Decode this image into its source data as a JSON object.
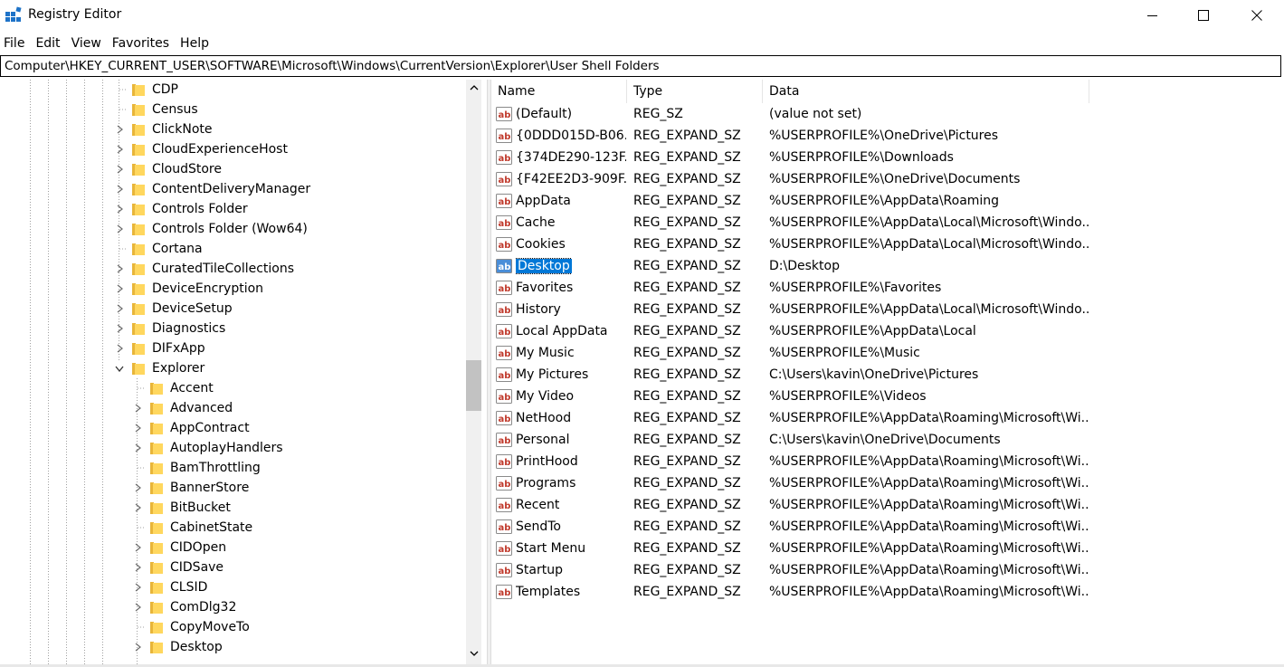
{
  "window": {
    "title": "Registry Editor"
  },
  "menu": [
    "File",
    "Edit",
    "View",
    "Favorites",
    "Help"
  ],
  "address": "Computer\\HKEY_CURRENT_USER\\SOFTWARE\\Microsoft\\Windows\\CurrentVersion\\Explorer\\User Shell Folders",
  "tree": {
    "items": [
      {
        "label": "CDP",
        "level": 1,
        "expander": "none"
      },
      {
        "label": "Census",
        "level": 1,
        "expander": "none"
      },
      {
        "label": "ClickNote",
        "level": 1,
        "expander": "collapsed"
      },
      {
        "label": "CloudExperienceHost",
        "level": 1,
        "expander": "collapsed"
      },
      {
        "label": "CloudStore",
        "level": 1,
        "expander": "collapsed"
      },
      {
        "label": "ContentDeliveryManager",
        "level": 1,
        "expander": "collapsed"
      },
      {
        "label": "Controls Folder",
        "level": 1,
        "expander": "collapsed"
      },
      {
        "label": "Controls Folder (Wow64)",
        "level": 1,
        "expander": "collapsed"
      },
      {
        "label": "Cortana",
        "level": 1,
        "expander": "none"
      },
      {
        "label": "CuratedTileCollections",
        "level": 1,
        "expander": "collapsed"
      },
      {
        "label": "DeviceEncryption",
        "level": 1,
        "expander": "collapsed"
      },
      {
        "label": "DeviceSetup",
        "level": 1,
        "expander": "collapsed"
      },
      {
        "label": "Diagnostics",
        "level": 1,
        "expander": "collapsed"
      },
      {
        "label": "DIFxApp",
        "level": 1,
        "expander": "collapsed"
      },
      {
        "label": "Explorer",
        "level": 1,
        "expander": "expanded"
      },
      {
        "label": "Accent",
        "level": 2,
        "expander": "none"
      },
      {
        "label": "Advanced",
        "level": 2,
        "expander": "collapsed"
      },
      {
        "label": "AppContract",
        "level": 2,
        "expander": "collapsed"
      },
      {
        "label": "AutoplayHandlers",
        "level": 2,
        "expander": "collapsed"
      },
      {
        "label": "BamThrottling",
        "level": 2,
        "expander": "none"
      },
      {
        "label": "BannerStore",
        "level": 2,
        "expander": "collapsed"
      },
      {
        "label": "BitBucket",
        "level": 2,
        "expander": "collapsed"
      },
      {
        "label": "CabinetState",
        "level": 2,
        "expander": "none"
      },
      {
        "label": "CIDOpen",
        "level": 2,
        "expander": "collapsed"
      },
      {
        "label": "CIDSave",
        "level": 2,
        "expander": "collapsed"
      },
      {
        "label": "CLSID",
        "level": 2,
        "expander": "collapsed"
      },
      {
        "label": "ComDlg32",
        "level": 2,
        "expander": "collapsed"
      },
      {
        "label": "CopyMoveTo",
        "level": 2,
        "expander": "none"
      },
      {
        "label": "Desktop",
        "level": 2,
        "expander": "collapsed"
      }
    ]
  },
  "list": {
    "columns": [
      "Name",
      "Type",
      "Data"
    ],
    "selected": "Desktop",
    "rows": [
      {
        "name": "(Default)",
        "type": "REG_SZ",
        "data": "(value not set)"
      },
      {
        "name": "{0DDD015D-B06...",
        "type": "REG_EXPAND_SZ",
        "data": "%USERPROFILE%\\OneDrive\\Pictures"
      },
      {
        "name": "{374DE290-123F...",
        "type": "REG_EXPAND_SZ",
        "data": "%USERPROFILE%\\Downloads"
      },
      {
        "name": "{F42EE2D3-909F...",
        "type": "REG_EXPAND_SZ",
        "data": "%USERPROFILE%\\OneDrive\\Documents"
      },
      {
        "name": "AppData",
        "type": "REG_EXPAND_SZ",
        "data": "%USERPROFILE%\\AppData\\Roaming"
      },
      {
        "name": "Cache",
        "type": "REG_EXPAND_SZ",
        "data": "%USERPROFILE%\\AppData\\Local\\Microsoft\\Windo..."
      },
      {
        "name": "Cookies",
        "type": "REG_EXPAND_SZ",
        "data": "%USERPROFILE%\\AppData\\Local\\Microsoft\\Windo..."
      },
      {
        "name": "Desktop",
        "type": "REG_EXPAND_SZ",
        "data": "D:\\Desktop"
      },
      {
        "name": "Favorites",
        "type": "REG_EXPAND_SZ",
        "data": "%USERPROFILE%\\Favorites"
      },
      {
        "name": "History",
        "type": "REG_EXPAND_SZ",
        "data": "%USERPROFILE%\\AppData\\Local\\Microsoft\\Windo..."
      },
      {
        "name": "Local AppData",
        "type": "REG_EXPAND_SZ",
        "data": "%USERPROFILE%\\AppData\\Local"
      },
      {
        "name": "My Music",
        "type": "REG_EXPAND_SZ",
        "data": "%USERPROFILE%\\Music"
      },
      {
        "name": "My Pictures",
        "type": "REG_EXPAND_SZ",
        "data": "C:\\Users\\kavin\\OneDrive\\Pictures"
      },
      {
        "name": "My Video",
        "type": "REG_EXPAND_SZ",
        "data": "%USERPROFILE%\\Videos"
      },
      {
        "name": "NetHood",
        "type": "REG_EXPAND_SZ",
        "data": "%USERPROFILE%\\AppData\\Roaming\\Microsoft\\Wi..."
      },
      {
        "name": "Personal",
        "type": "REG_EXPAND_SZ",
        "data": "C:\\Users\\kavin\\OneDrive\\Documents"
      },
      {
        "name": "PrintHood",
        "type": "REG_EXPAND_SZ",
        "data": "%USERPROFILE%\\AppData\\Roaming\\Microsoft\\Wi..."
      },
      {
        "name": "Programs",
        "type": "REG_EXPAND_SZ",
        "data": "%USERPROFILE%\\AppData\\Roaming\\Microsoft\\Wi..."
      },
      {
        "name": "Recent",
        "type": "REG_EXPAND_SZ",
        "data": "%USERPROFILE%\\AppData\\Roaming\\Microsoft\\Wi..."
      },
      {
        "name": "SendTo",
        "type": "REG_EXPAND_SZ",
        "data": "%USERPROFILE%\\AppData\\Roaming\\Microsoft\\Wi..."
      },
      {
        "name": "Start Menu",
        "type": "REG_EXPAND_SZ",
        "data": "%USERPROFILE%\\AppData\\Roaming\\Microsoft\\Wi..."
      },
      {
        "name": "Startup",
        "type": "REG_EXPAND_SZ",
        "data": "%USERPROFILE%\\AppData\\Roaming\\Microsoft\\Wi..."
      },
      {
        "name": "Templates",
        "type": "REG_EXPAND_SZ",
        "data": "%USERPROFILE%\\AppData\\Roaming\\Microsoft\\Wi..."
      }
    ]
  },
  "icons": {
    "app": "registry-editor-icon",
    "folder": "folder-icon",
    "value": "string-value-icon",
    "minimize": "minimize-icon",
    "maximize": "maximize-icon",
    "close": "close-icon"
  },
  "colors": {
    "selection": "#0078d7",
    "folder": "#ffd75e",
    "folder_dark": "#e8b53a",
    "value_icon": "#c0392b"
  }
}
